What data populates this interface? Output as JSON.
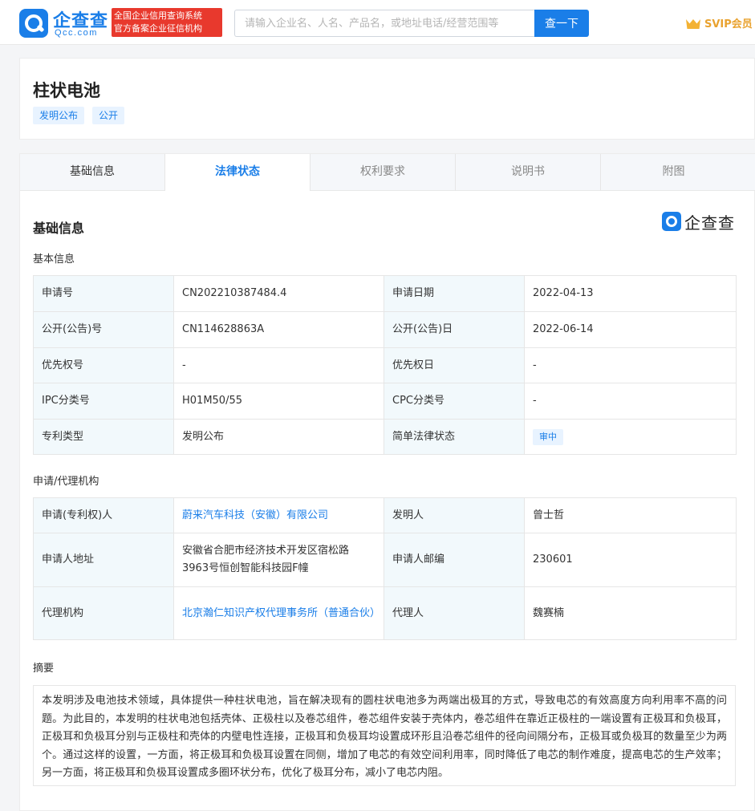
{
  "header": {
    "logo_text": "企查查",
    "logo_domain": "Qcc.com",
    "slogan_line1": "全国企业信用查询系统",
    "slogan_line2": "官方备案企业征信机构",
    "search_placeholder": "请输入企业名、人名、产品名，或地址电话/经营范围等",
    "search_button": "查一下",
    "vip_label": "SVIP会员"
  },
  "patent": {
    "title": "柱状电池",
    "tags": [
      "发明公布",
      "公开"
    ]
  },
  "tabs": [
    {
      "label": "基础信息"
    },
    {
      "label": "法律状态"
    },
    {
      "label": "权利要求"
    },
    {
      "label": "说明书"
    },
    {
      "label": "附图"
    }
  ],
  "section": {
    "title": "基础信息",
    "watermark": "企查查"
  },
  "basic": {
    "title": "基本信息",
    "rows": [
      {
        "l1": "申请号",
        "v1": "CN202210387484.4",
        "l2": "申请日期",
        "v2": "2022-04-13"
      },
      {
        "l1": "公开(公告)号",
        "v1": "CN114628863A",
        "l2": "公开(公告)日",
        "v2": "2022-06-14"
      },
      {
        "l1": "优先权号",
        "v1": "-",
        "l2": "优先权日",
        "v2": "-"
      },
      {
        "l1": "IPC分类号",
        "v1": "H01M50/55",
        "l2": "CPC分类号",
        "v2": "-"
      },
      {
        "l1": "专利类型",
        "v1": "发明公布",
        "l2": "简单法律状态",
        "v2": "审中"
      }
    ]
  },
  "agency": {
    "title": "申请/代理机构",
    "rows": [
      {
        "l1": "申请(专利权)人",
        "v1": "蔚来汽车科技（安徽）有限公司",
        "l2": "发明人",
        "v2": "曾士哲"
      },
      {
        "l1": "申请人地址",
        "v1": "安徽省合肥市经济技术开发区宿松路3963号恒创智能科技园F幢",
        "l2": "申请人邮编",
        "v2": "230601"
      },
      {
        "l1": "代理机构",
        "v1": "北京瀚仁知识产权代理事务所（普通合伙）",
        "l2": "代理人",
        "v2": "魏赛楠"
      }
    ]
  },
  "abstract": {
    "title": "摘要",
    "text": "本发明涉及电池技术领域，具体提供一种柱状电池，旨在解决现有的圆柱状电池多为两端出极耳的方式，导致电芯的有效高度方向利用率不高的问题。为此目的，本发明的柱状电池包括壳体、正极柱以及卷芯组件，卷芯组件安装于壳体内，卷芯组件在靠近正极柱的一端设置有正极耳和负极耳，正极耳和负极耳分别与正极柱和壳体的内壁电性连接，正极耳和负极耳均设置成环形且沿卷芯组件的径向间隔分布，正极耳或负极耳的数量至少为两个。通过这样的设置，一方面，将正极耳和负极耳设置在同侧，增加了电芯的有效空间利用率，同时降低了电芯的制作难度，提高电芯的生产效率；另一方面，将正极耳和负极耳设置成多圈环状分布，优化了极耳分布，减小了电芯内阻。"
  }
}
